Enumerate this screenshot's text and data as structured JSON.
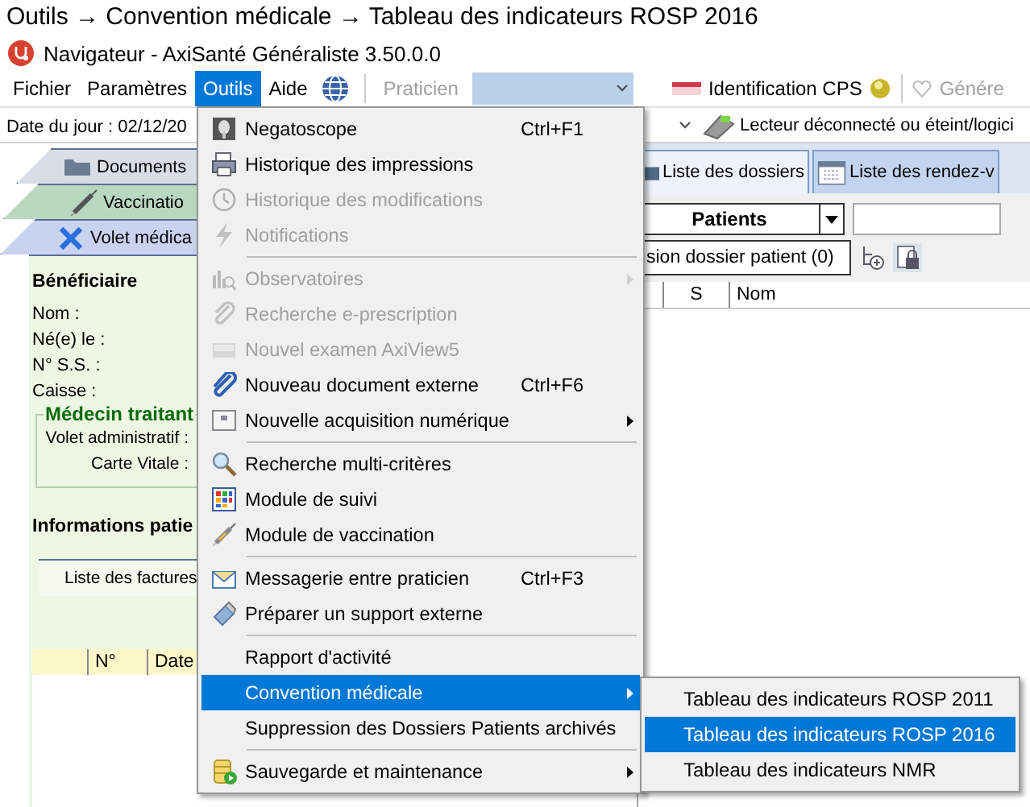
{
  "breadcrumb": "Outils → Convention médicale → Tableau des indicateurs ROSP 2016",
  "window": {
    "title": "Navigateur - AxiSanté Généraliste 3.50.0.0"
  },
  "menubar": {
    "items": [
      {
        "label": "Fichier",
        "selected": false
      },
      {
        "label": "Paramètres",
        "selected": false
      },
      {
        "label": "Outils",
        "selected": true
      },
      {
        "label": "Aide",
        "selected": false
      }
    ],
    "praticien": {
      "label": "Praticien",
      "disabled": true
    },
    "cps": {
      "label": "Identification CPS"
    },
    "generate": {
      "label": "Génére",
      "disabled": true
    }
  },
  "info_bar": {
    "date": "Date du jour : 02/12/20",
    "reader_status": "Lecteur déconnecté ou éteint/logici"
  },
  "left_panel": {
    "tabs": [
      {
        "label": "Documents",
        "color": "#d9dde6"
      },
      {
        "label": "Vaccinatio",
        "color": "#b9d8c0"
      },
      {
        "label": "Volet médica",
        "color": "#c9d3f0"
      }
    ],
    "beneficiary": {
      "title": "Bénéficiaire",
      "fields": [
        "Nom :",
        "Né(e) le :",
        "N° S.S. :",
        "Caisse :"
      ]
    },
    "doctor": {
      "title": "Médecin traitant",
      "fields": [
        "Volet administratif :",
        "Carte Vitale :"
      ]
    },
    "patient_info": {
      "title": "Informations patie",
      "tabs": [
        {
          "label": "Liste des factures"
        }
      ],
      "columns": [
        "N°",
        "Date"
      ]
    }
  },
  "right_panel": {
    "tabs": [
      {
        "label": "Liste des dossiers",
        "selected": true
      },
      {
        "label": "Liste des rendez-v",
        "selected": false
      }
    ],
    "category": "Patients",
    "archive_button": "sion dossier patient (0)",
    "columns": [
      "S",
      "Nom"
    ]
  },
  "menu": {
    "items": [
      {
        "kind": "item",
        "label": "Negatoscope",
        "shortcut": "Ctrl+F1",
        "disabled": false,
        "submenu": false,
        "selected": false
      },
      {
        "kind": "item",
        "label": "Historique des impressions",
        "disabled": false,
        "submenu": false,
        "selected": false
      },
      {
        "kind": "item",
        "label": "Historique des modifications",
        "disabled": true,
        "submenu": false,
        "selected": false
      },
      {
        "kind": "item",
        "label": "Notifications",
        "disabled": true,
        "submenu": false,
        "selected": false
      },
      {
        "kind": "separator"
      },
      {
        "kind": "item",
        "label": "Observatoires",
        "disabled": true,
        "submenu": true,
        "selected": false
      },
      {
        "kind": "item",
        "label": "Recherche e-prescription",
        "disabled": true,
        "submenu": false,
        "selected": false
      },
      {
        "kind": "item",
        "label": "Nouvel examen AxiView5",
        "disabled": true,
        "submenu": false,
        "selected": false
      },
      {
        "kind": "item",
        "label": "Nouveau document externe",
        "shortcut": "Ctrl+F6",
        "disabled": false,
        "submenu": false,
        "selected": false
      },
      {
        "kind": "item",
        "label": "Nouvelle acquisition numérique",
        "disabled": false,
        "submenu": true,
        "selected": false
      },
      {
        "kind": "separator"
      },
      {
        "kind": "item",
        "label": "Recherche multi-critères",
        "disabled": false,
        "submenu": false,
        "selected": false
      },
      {
        "kind": "item",
        "label": "Module de suivi",
        "disabled": false,
        "submenu": false,
        "selected": false
      },
      {
        "kind": "item",
        "label": "Module de vaccination",
        "disabled": false,
        "submenu": false,
        "selected": false
      },
      {
        "kind": "separator"
      },
      {
        "kind": "item",
        "label": "Messagerie entre praticien",
        "shortcut": "Ctrl+F3",
        "disabled": false,
        "submenu": false,
        "selected": false
      },
      {
        "kind": "item",
        "label": "Préparer un support externe",
        "disabled": false,
        "submenu": false,
        "selected": false
      },
      {
        "kind": "separator"
      },
      {
        "kind": "item",
        "label": "Rapport d'activité",
        "disabled": false,
        "submenu": false,
        "selected": false
      },
      {
        "kind": "item",
        "label": "Convention médicale",
        "disabled": false,
        "submenu": true,
        "selected": true
      },
      {
        "kind": "item",
        "label": "Suppression des Dossiers Patients archivés",
        "disabled": false,
        "submenu": false,
        "selected": false
      },
      {
        "kind": "separator"
      },
      {
        "kind": "item",
        "label": "Sauvegarde et maintenance",
        "disabled": false,
        "submenu": true,
        "selected": false
      }
    ]
  },
  "submenu": {
    "items": [
      {
        "label": "Tableau des indicateurs ROSP 2011",
        "selected": false
      },
      {
        "label": "Tableau des indicateurs ROSP 2016",
        "selected": true
      },
      {
        "label": "Tableau des indicateurs NMR",
        "selected": false
      }
    ]
  }
}
